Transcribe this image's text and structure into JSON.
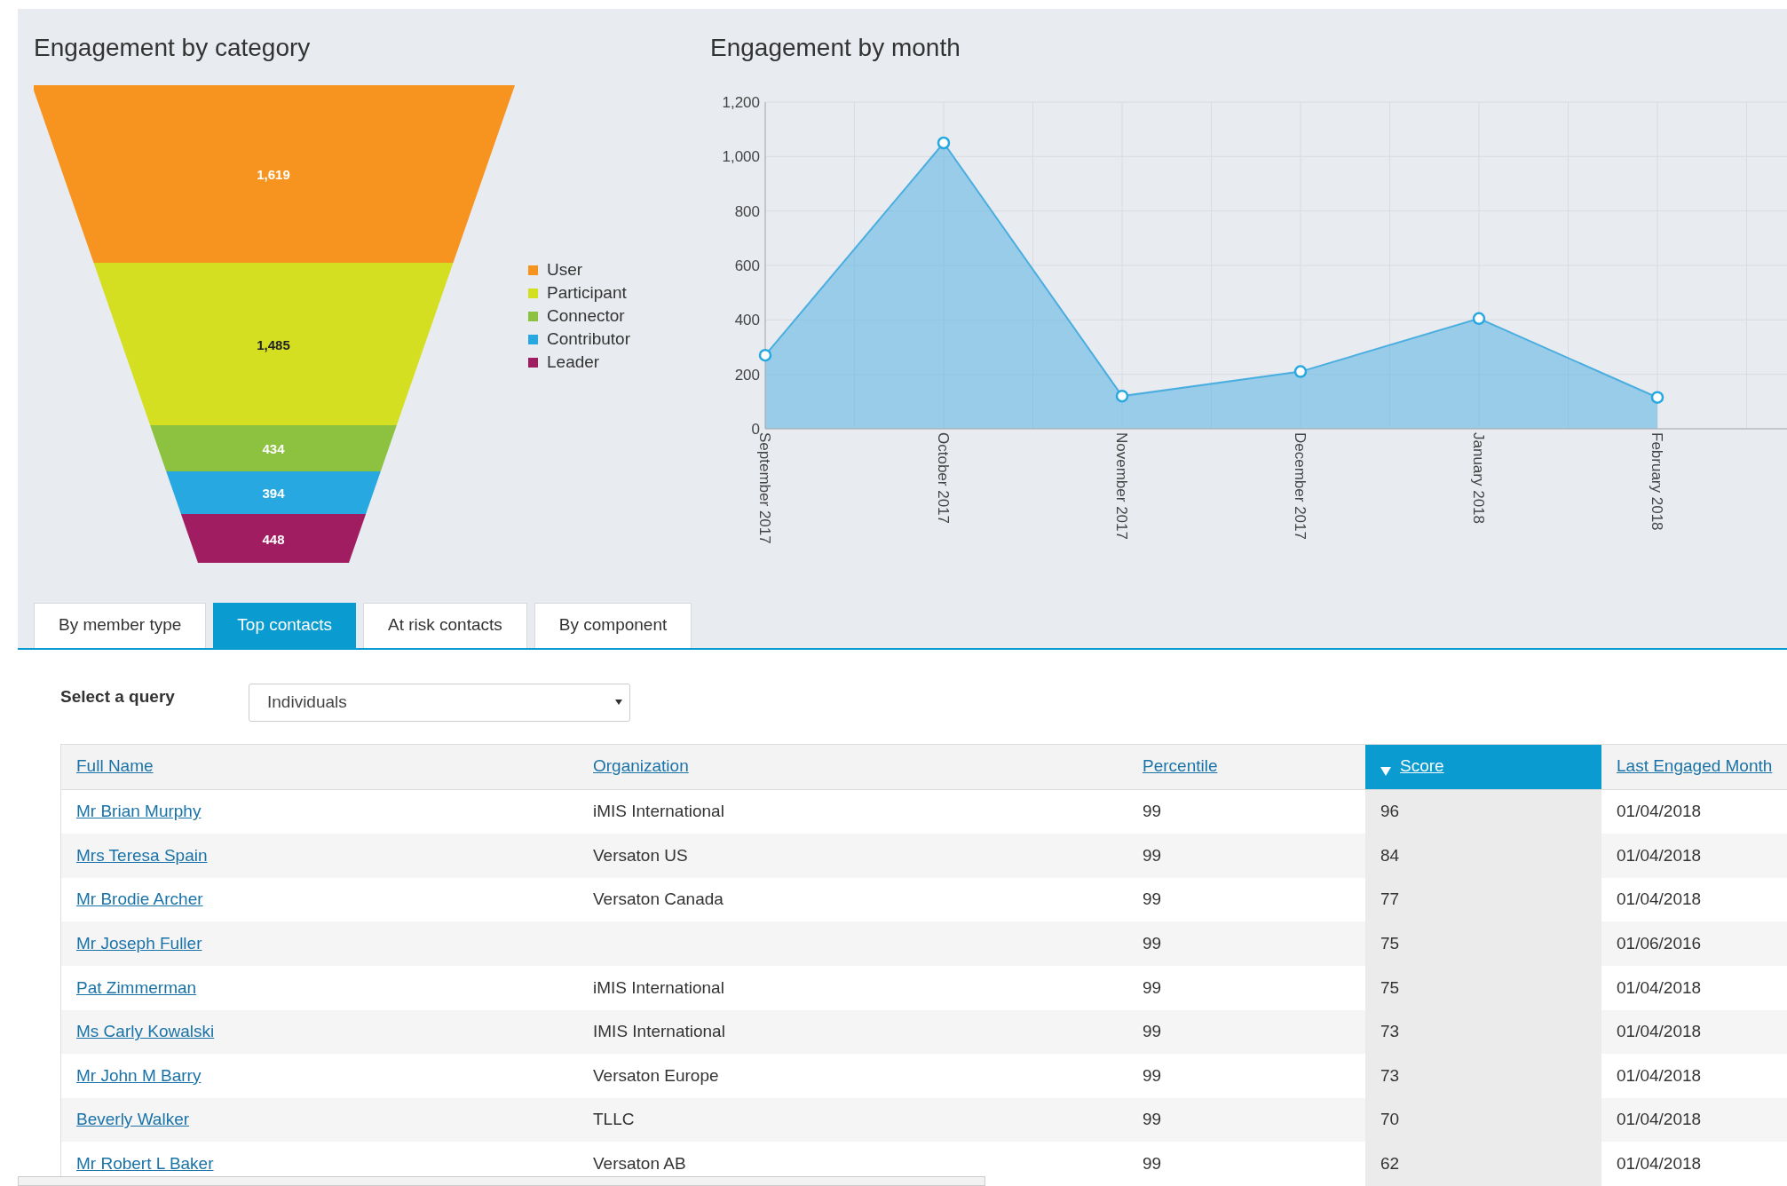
{
  "funnel_panel": {
    "title": "Engagement by category",
    "segments": [
      {
        "label": "User",
        "value": "1,619",
        "color": "#f6941f"
      },
      {
        "label": "Participant",
        "value": "1,485",
        "color": "#d5df22"
      },
      {
        "label": "Connector",
        "value": "434",
        "color": "#8cc23f"
      },
      {
        "label": "Contributor",
        "value": "394",
        "color": "#27a8e0"
      },
      {
        "label": "Leader",
        "value": "448",
        "color": "#a11d62"
      }
    ]
  },
  "month_panel": {
    "chart_data": {
      "type": "area",
      "title": "Engagement by month",
      "categories": [
        "September 2017",
        "October 2017",
        "November 2017",
        "December 2017",
        "January 2018",
        "February 2018"
      ],
      "series": [
        {
          "color": "#4aaee0",
          "values": [
            270,
            1050,
            120,
            210,
            405,
            115
          ]
        }
      ],
      "grid": true,
      "ylim": [
        0,
        1200
      ],
      "yticks": [
        0,
        200,
        400,
        600,
        800,
        {
          "value": 1000,
          "label": "1,000"
        },
        {
          "value": 1200,
          "label": "1,200"
        }
      ]
    }
  },
  "tabs": [
    {
      "label": "By member type",
      "selected": false
    },
    {
      "label": "Top contacts",
      "selected": true
    },
    {
      "label": "At risk contacts",
      "selected": false
    },
    {
      "label": "By component",
      "selected": false
    }
  ],
  "query": {
    "label": "Select a query",
    "value": "Individuals"
  },
  "table": {
    "columns": [
      {
        "label": "Full Name",
        "sorted": false
      },
      {
        "label": "Organization",
        "sorted": false
      },
      {
        "label": "Percentile",
        "sorted": false
      },
      {
        "label": "Score",
        "sorted": true
      },
      {
        "label": "Last Engaged Month",
        "sorted": false
      }
    ],
    "rows": [
      {
        "name": "Mr Brian Murphy",
        "organization": "iMIS International",
        "percentile": "99",
        "score": "96",
        "last_engaged": "01/04/2018"
      },
      {
        "name": "Mrs Teresa Spain",
        "organization": "Versaton US",
        "percentile": "99",
        "score": "84",
        "last_engaged": "01/04/2018"
      },
      {
        "name": "Mr Brodie Archer",
        "organization": "Versaton Canada",
        "percentile": "99",
        "score": "77",
        "last_engaged": "01/04/2018"
      },
      {
        "name": "Mr Joseph Fuller",
        "percentile": "99",
        "score": "75",
        "last_engaged": "01/06/2016"
      },
      {
        "name": "Pat Zimmerman",
        "organization": "iMIS International",
        "percentile": "99",
        "score": "75",
        "last_engaged": "01/04/2018"
      },
      {
        "name": "Ms Carly Kowalski",
        "organization": "IMIS International",
        "percentile": "99",
        "score": "73",
        "last_engaged": "01/04/2018"
      },
      {
        "name": "Mr John M Barry",
        "organization": "Versaton Europe",
        "percentile": "99",
        "score": "73",
        "last_engaged": "01/04/2018"
      },
      {
        "name": "Beverly Walker",
        "organization": "TLLC",
        "percentile": "99",
        "score": "70",
        "last_engaged": "01/04/2018"
      },
      {
        "name": "Mr Robert L Baker",
        "organization": "Versaton AB",
        "percentile": "99",
        "score": "62",
        "last_engaged": "01/04/2018"
      }
    ]
  }
}
